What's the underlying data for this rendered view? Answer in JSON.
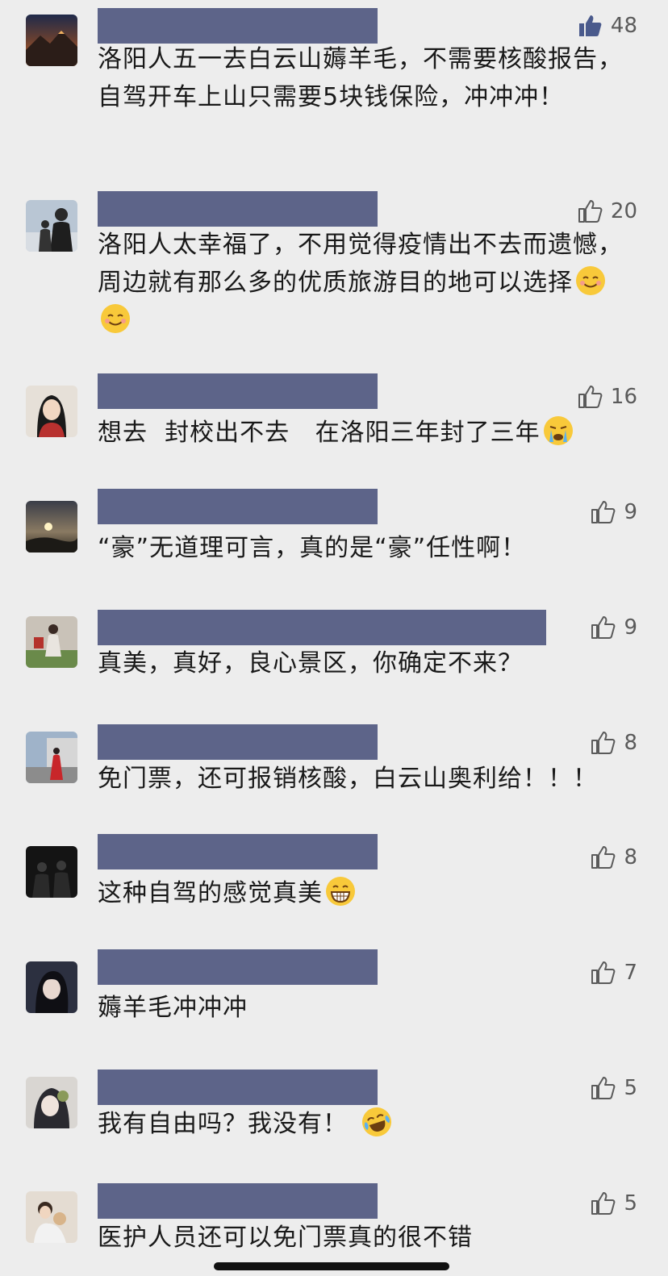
{
  "comments": [
    {
      "likes": "48",
      "text": "洛阳人五一去白云山薅羊毛，不需要核酸报告，自驾开车上山只需要5块钱保险，冲冲冲！",
      "liked": true
    },
    {
      "likes": "20",
      "text": "洛阳人太幸福了，不用觉得疫情出不去而遗憾，周边就有那么多的优质旅游目的地可以选择"
    },
    {
      "likes": "16",
      "text": "想去  封校出不去   在洛阳三年封了三年"
    },
    {
      "likes": "9",
      "text": "“豪”无道理可言，真的是“豪”任性啊！"
    },
    {
      "likes": "9",
      "text": "真美，真好，良心景区，你确定不来？"
    },
    {
      "likes": "8",
      "text": "免门票，还可报销核酸，白云山奥利给！！！"
    },
    {
      "likes": "8",
      "text": "这种自驾的感觉真美"
    },
    {
      "likes": "7",
      "text": "薅羊毛冲冲冲"
    },
    {
      "likes": "5",
      "text": "我有自由吗？我没有！"
    },
    {
      "likes": "5",
      "text": "医护人员还可以免门票真的很不错"
    }
  ],
  "colors": {
    "background": "#ededed",
    "name_redaction": "#5d6489",
    "like_active": "#4a5a8c",
    "like_inactive": "#5a5a5a"
  },
  "icons": {
    "like": "thumbs-up-icon",
    "smile": "smiling-emoji-icon",
    "cry": "crying-emoji-icon",
    "grin": "grinning-emoji-icon",
    "laugh_cry": "laughing-crying-emoji-icon"
  }
}
